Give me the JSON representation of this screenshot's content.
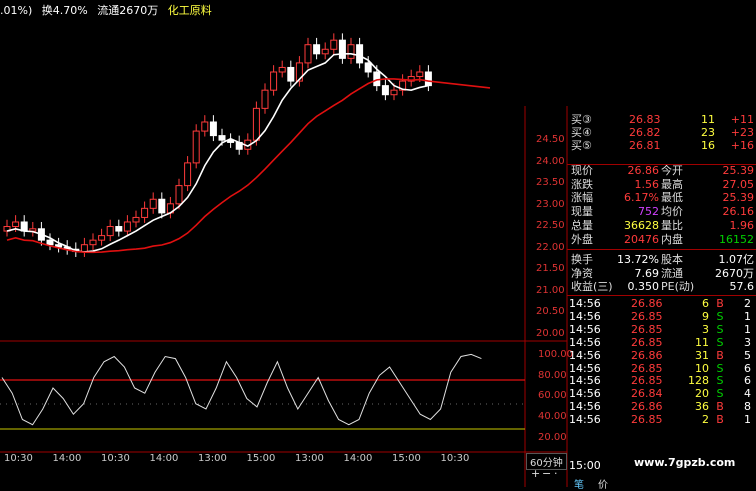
{
  "header": {
    "change_pct_fragment": ".01%)",
    "turnover": "换4.70%",
    "float_shares": "流通2670万",
    "sector": "化工原料"
  },
  "y_axis_main": [
    "24.50",
    "24.00",
    "23.50",
    "23.00",
    "22.50",
    "22.00",
    "21.50",
    "21.00",
    "20.50",
    "20.00"
  ],
  "y_axis_osc": [
    "100.00",
    "80.00",
    "60.00",
    "40.00",
    "20.00"
  ],
  "x_axis": [
    "10:30",
    "14:00",
    "10:30",
    "14:00",
    "13:00",
    "15:00",
    "13:00",
    "14:00",
    "15:00",
    "10:30"
  ],
  "period_button": "60分钟",
  "zoom_controls": {
    "plus": "+",
    "minus": "−",
    "dot": "·"
  },
  "quote": {
    "buy_levels": [
      {
        "label": "买③",
        "price": "26.83",
        "vol": "11",
        "chg": "+11"
      },
      {
        "label": "买④",
        "price": "26.82",
        "vol": "23",
        "chg": "+23"
      },
      {
        "label": "买⑤",
        "price": "26.81",
        "vol": "16",
        "chg": "+16"
      }
    ],
    "stats": [
      {
        "l1": "现价",
        "v1": "26.86",
        "l2": "今开",
        "v2": "25.39"
      },
      {
        "l1": "涨跌",
        "v1": "1.56",
        "l2": "最高",
        "v2": "27.05"
      },
      {
        "l1": "涨幅",
        "v1": "6.17%",
        "l2": "最低",
        "v2": "25.39"
      },
      {
        "l1": "现量",
        "v1": "752",
        "l2": "均价",
        "v2": "26.16"
      },
      {
        "l1": "总量",
        "v1": "36628",
        "l2": "量比",
        "v2": "1.96"
      },
      {
        "l1": "外盘",
        "v1": "20476",
        "l2": "内盘",
        "v2": "16152"
      }
    ],
    "info": [
      {
        "l1": "换手",
        "v1": "13.72%",
        "l2": "股本",
        "v2": "1.07亿"
      },
      {
        "l1": "净资",
        "v1": "7.69",
        "l2": "流通",
        "v2": "2670万"
      },
      {
        "l1": "收益(三)",
        "v1": "0.350",
        "l2": "PE(动)",
        "v2": "57.6"
      }
    ],
    "ticks": [
      {
        "time": "14:56",
        "price": "26.86",
        "vol": "6",
        "side": "B",
        "n": "2"
      },
      {
        "time": "14:56",
        "price": "26.85",
        "vol": "9",
        "side": "S",
        "n": "1"
      },
      {
        "time": "14:56",
        "price": "26.85",
        "vol": "3",
        "side": "S",
        "n": "1"
      },
      {
        "time": "14:56",
        "price": "26.85",
        "vol": "11",
        "side": "S",
        "n": "3"
      },
      {
        "time": "14:56",
        "price": "26.86",
        "vol": "31",
        "side": "B",
        "n": "5"
      },
      {
        "time": "14:56",
        "price": "26.85",
        "vol": "10",
        "side": "S",
        "n": "6"
      },
      {
        "time": "14:56",
        "price": "26.85",
        "vol": "128",
        "side": "S",
        "n": "6"
      },
      {
        "time": "14:56",
        "price": "26.84",
        "vol": "20",
        "side": "S",
        "n": "4"
      },
      {
        "time": "14:56",
        "price": "26.86",
        "vol": "36",
        "side": "B",
        "n": "8"
      },
      {
        "time": "14:56",
        "price": "26.85",
        "vol": "2",
        "side": "B",
        "n": "1"
      }
    ],
    "last_time": "15:00"
  },
  "watermark": "www.7gpzb.com",
  "bottom_tabs": [
    "笔",
    "价"
  ],
  "colors": {
    "up": "#ff3b3b",
    "down": "#00d000",
    "yellow": "#ffff40",
    "white": "#ffffff",
    "purple": "#d040ff",
    "frame": "#a00000"
  }
}
